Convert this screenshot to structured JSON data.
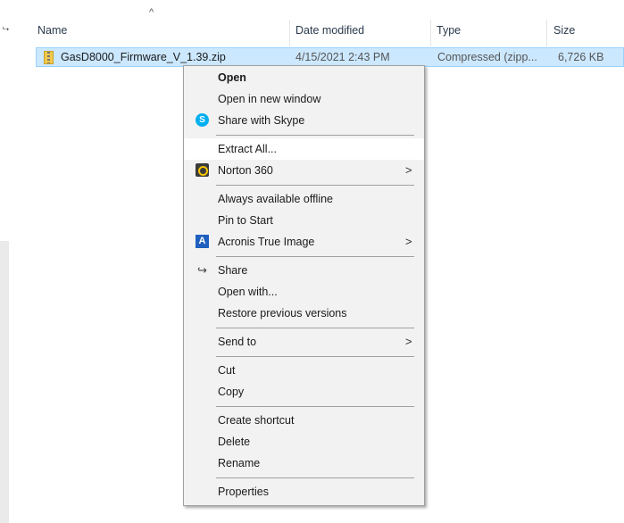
{
  "header": {
    "columns": [
      "Name",
      "Date modified",
      "Type",
      "Size"
    ],
    "sort_indicator": "^"
  },
  "file": {
    "name": "GasD8000_Firmware_V_1.39.zip",
    "date": "4/15/2021 2:43 PM",
    "type": "Compressed (zipp...",
    "size": "6,726 KB",
    "icon": "zip-folder-icon"
  },
  "menu": {
    "items": [
      {
        "label": "Open",
        "bold": true
      },
      {
        "label": "Open in new window"
      },
      {
        "label": "Share with Skype",
        "icon": "skype-icon"
      },
      {
        "label": "Extract All..."
      },
      {
        "label": "Norton 360",
        "icon": "norton-icon",
        "submenu": true
      },
      {
        "label": "Always available offline"
      },
      {
        "label": "Pin to Start"
      },
      {
        "label": "Acronis True Image",
        "icon": "acronis-icon",
        "submenu": true
      },
      {
        "label": "Share",
        "icon": "share-icon"
      },
      {
        "label": "Open with..."
      },
      {
        "label": "Restore previous versions"
      },
      {
        "label": "Send to",
        "submenu": true
      },
      {
        "label": "Cut"
      },
      {
        "label": "Copy"
      },
      {
        "label": "Create shortcut"
      },
      {
        "label": "Delete"
      },
      {
        "label": "Rename"
      },
      {
        "label": "Properties"
      }
    ],
    "highlighted": "Extract All...",
    "submenu_arrow": ">"
  },
  "colors": {
    "selection": "#cce8ff",
    "selection_border": "#99d1ff",
    "menu_bg": "#f2f2f2",
    "menu_hover": "#ffffff"
  }
}
